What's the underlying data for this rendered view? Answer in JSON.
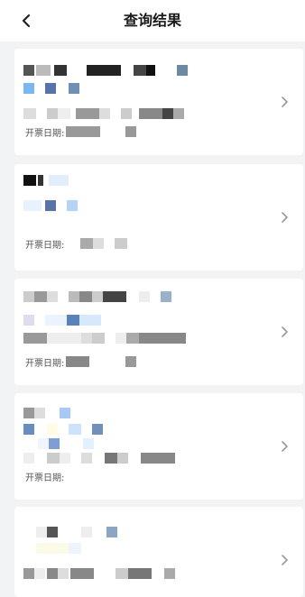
{
  "header": {
    "title": "查询结果"
  },
  "invoice_date_label": "开票日期:",
  "icons": {
    "back": "chevron-left-icon",
    "item_arrow": "chevron-right-icon"
  },
  "colors": {
    "background": "#f2f3f5",
    "card": "#ffffff",
    "title": "#1a1a1a",
    "arrow": "#999999"
  },
  "cards": [
    {
      "date_label": "开票日期:"
    },
    {
      "date_label": "开票日期:"
    },
    {
      "date_label": "开票日期:"
    },
    {
      "date_label": "开票日期:"
    },
    {
      "date_label": ""
    }
  ]
}
